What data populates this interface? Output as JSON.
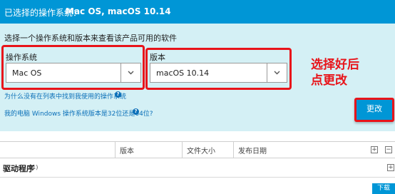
{
  "header": {
    "selected_os_label": "已选择的操作系统：",
    "selected_os_value": "Mac OS, macOS 10.14"
  },
  "panel": {
    "instruction": "选择一个操作系统和版本来查看该产品可用的软件",
    "os_label": "操作系统",
    "os_value": "Mac OS",
    "version_label": "版本",
    "version_value": "macOS 10.14",
    "link_not_found": "为什么没有在列表中找到我使用的操作系统",
    "link_bitness": "我的电脑 Windows 操作系统版本是32位还是64位?",
    "help_glyph": "?",
    "change_button": "更改"
  },
  "annotation": {
    "line1": "选择好后",
    "line2": "点更改",
    "color": "#e8141a"
  },
  "table": {
    "headers": [
      "版本",
      "文件大小",
      "发布日期"
    ],
    "expand_glyph": "+",
    "collapse_glyph": "−"
  },
  "section": {
    "title": "驱动程序",
    "count": "(1)",
    "expand_glyph": "+"
  },
  "download_button": "下载",
  "colors": {
    "brand_blue": "#0096d6",
    "panel_bg": "#d4f0f5",
    "link_blue": "#0a6fb8",
    "highlight_red": "#e8141a"
  }
}
